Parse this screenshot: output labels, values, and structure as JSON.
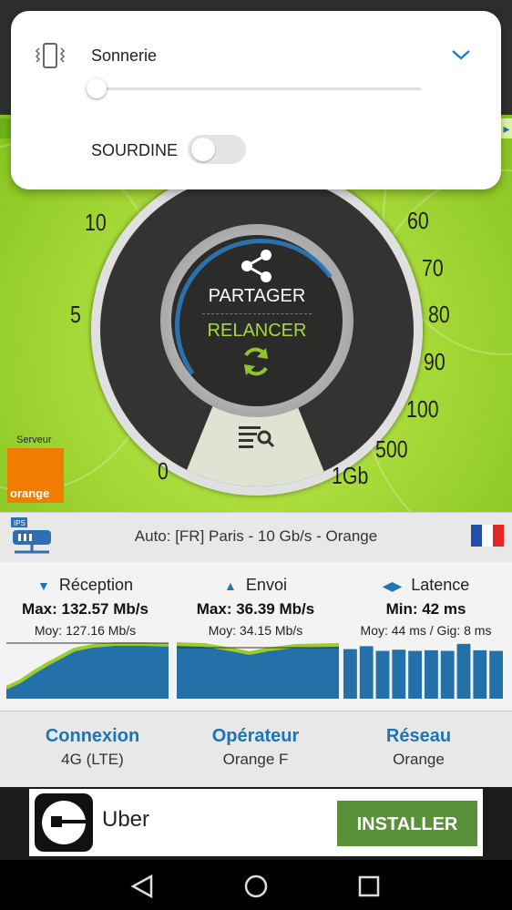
{
  "volume_panel": {
    "title": "Sonnerie",
    "mute_label": "SOURDINE",
    "volume_level": 0,
    "mute_on": false
  },
  "speedometer": {
    "scale_labels": [
      "0",
      "5",
      "10",
      "60",
      "70",
      "80",
      "90",
      "100",
      "500",
      "1Gb"
    ],
    "share_label": "PARTAGER",
    "restart_label": "RELANCER"
  },
  "server": {
    "label": "Serveur",
    "provider_logo_text": "orange",
    "ips_label": "IPS",
    "description": "Auto: [FR] Paris - 10 Gb/s - Orange"
  },
  "stats": {
    "reception": {
      "label": "Réception",
      "max": "Max: 132.57 Mb/s",
      "avg": "Moy: 127.16 Mb/s"
    },
    "upload": {
      "label": "Envoi",
      "max": "Max: 36.39 Mb/s",
      "avg": "Moy: 34.15 Mb/s"
    },
    "latency": {
      "label": "Latence",
      "min": "Min: 42 ms",
      "avg": "Moy: 44 ms / Gig: 8 ms",
      "bars": [
        0.85,
        0.9,
        0.82,
        0.84,
        0.82,
        0.83,
        0.82,
        0.94,
        0.83,
        0.82
      ]
    }
  },
  "network_info": {
    "connection": {
      "title": "Connexion",
      "value": "4G (LTE)"
    },
    "operator": {
      "title": "Opérateur",
      "value": "Orange F"
    },
    "network": {
      "title": "Réseau",
      "value": "Orange"
    }
  },
  "ad": {
    "app_name": "Uber",
    "install_label": "INSTALLER"
  },
  "colors": {
    "accent_blue": "#1f74b5",
    "green": "#a9dc3a",
    "install_green": "#58913a"
  }
}
